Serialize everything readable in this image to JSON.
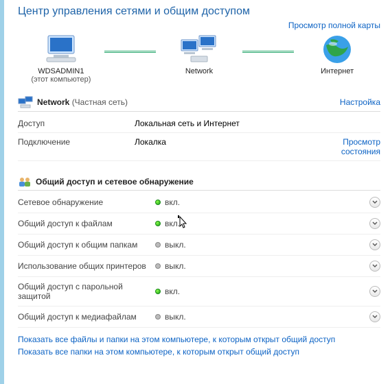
{
  "title": "Центр управления сетями и общим доступом",
  "view_full_map": "Просмотр полной карты",
  "map": {
    "this_pc": {
      "name": "WDSADMIN1",
      "subtitle": "(этот компьютер)"
    },
    "network": {
      "name": "Network"
    },
    "internet": {
      "name": "Интернет"
    }
  },
  "network_section": {
    "name": "Network",
    "type": "(Частная сеть)",
    "configure": "Настройка",
    "rows": {
      "access": {
        "label": "Доступ",
        "value": "Локальная сеть и Интернет"
      },
      "connection": {
        "label": "Подключение",
        "value": "Локалка",
        "status_link": "Просмотр состояния"
      }
    }
  },
  "sharing_section": {
    "title": "Общий доступ и сетевое обнаружение",
    "on_label": "вкл.",
    "off_label": "выкл.",
    "items": [
      {
        "label": "Сетевое обнаружение",
        "state": "on"
      },
      {
        "label": "Общий доступ к файлам",
        "state": "on"
      },
      {
        "label": "Общий доступ к общим папкам",
        "state": "off"
      },
      {
        "label": "Использование общих принтеров",
        "state": "off"
      },
      {
        "label": "Общий доступ с парольной защитой",
        "state": "on"
      },
      {
        "label": "Общий доступ к медиафайлам",
        "state": "off"
      }
    ]
  },
  "footer": {
    "link1": "Показать все файлы и папки на этом компьютере, к которым открыт общий доступ",
    "link2": "Показать все папки на этом компьютере, к которым открыт общий доступ"
  }
}
